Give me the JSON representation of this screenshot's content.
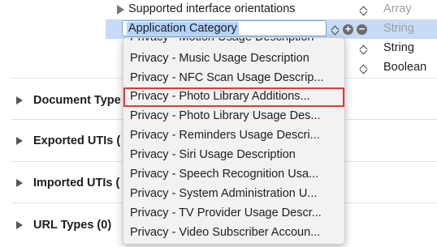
{
  "plist": {
    "orientations": {
      "key": "Supported interface orientations",
      "type": "Array"
    },
    "category_row": {
      "key": "Application Category",
      "type": "String"
    },
    "row3": {
      "type": "String"
    },
    "row4": {
      "type": "Boolean"
    }
  },
  "sections": [
    {
      "label": "Document Type"
    },
    {
      "label": "Exported UTIs ("
    },
    {
      "label": "Imported UTIs ("
    },
    {
      "label": "URL Types (0)"
    }
  ],
  "dropdown": {
    "clipped_top_item": "Privacy - Motion Usage Description",
    "items": [
      "Privacy - Music Usage Description",
      "Privacy - NFC Scan Usage Descrip...",
      "Privacy - Photo Library Additions...",
      "Privacy - Photo Library Usage Des...",
      "Privacy - Reminders Usage Descri...",
      "Privacy - Siri Usage Description",
      "Privacy - Speech Recognition Usa...",
      "Privacy - System Administration U...",
      "Privacy - TV Provider Usage Descr...",
      "Privacy - Video Subscriber Accoun..."
    ],
    "highlighted_index": 2,
    "highlight_color": "#e53935"
  },
  "colors": {
    "selected_row": "#c6dbf5",
    "field_border": "#6aa6ec",
    "text_selection": "#b3d4fc"
  },
  "icons": {
    "disclosure": "disclosure-triangle-icon",
    "stepper": "stepper-icon",
    "add": "add-circle-icon",
    "remove": "remove-circle-icon"
  }
}
